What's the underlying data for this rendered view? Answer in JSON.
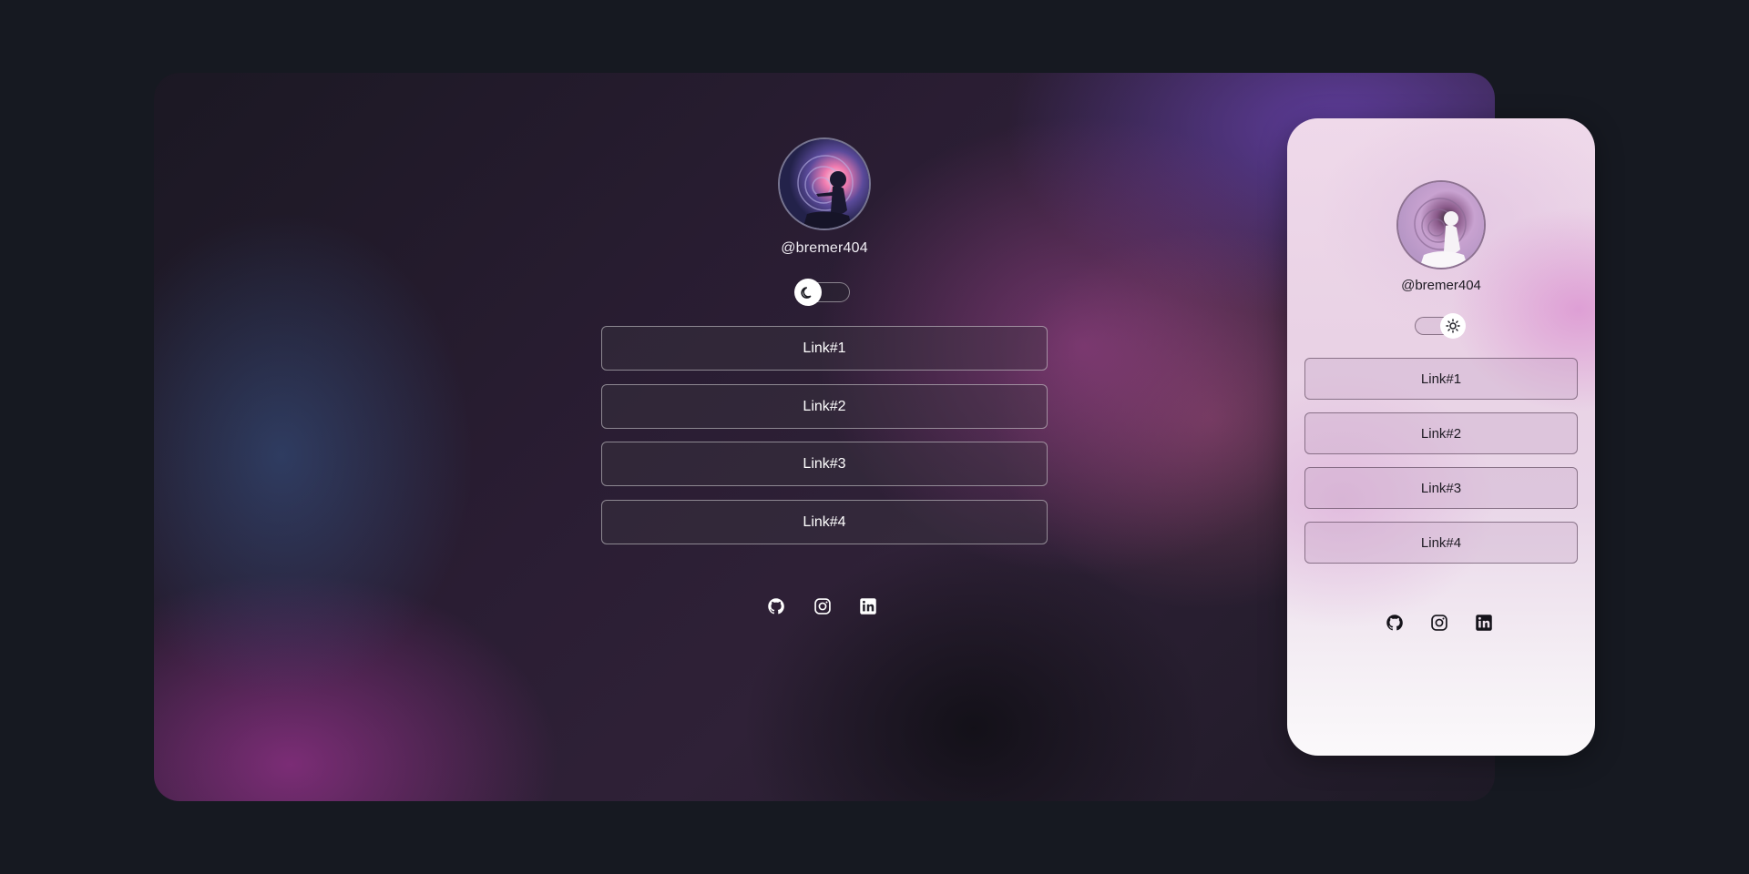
{
  "desktop": {
    "handle": "@bremer404",
    "theme_toggle": {
      "mode": "dark",
      "icon": "moon-icon"
    },
    "links": [
      {
        "label": "Link#1"
      },
      {
        "label": "Link#2"
      },
      {
        "label": "Link#3"
      },
      {
        "label": "Link#4"
      }
    ],
    "socials": [
      "github-icon",
      "instagram-icon",
      "linkedin-icon"
    ]
  },
  "mobile": {
    "handle": "@bremer404",
    "theme_toggle": {
      "mode": "light",
      "icon": "sun-icon"
    },
    "links": [
      {
        "label": "Link#1"
      },
      {
        "label": "Link#2"
      },
      {
        "label": "Link#3"
      },
      {
        "label": "Link#4"
      }
    ],
    "socials": [
      "github-icon",
      "instagram-icon",
      "linkedin-icon"
    ]
  },
  "colors": {
    "page_background": "#161921",
    "dark_text": "#ffffff",
    "light_text": "#1d1a22",
    "accent_purple": "#6e46be",
    "accent_pink": "#dc96d2"
  }
}
